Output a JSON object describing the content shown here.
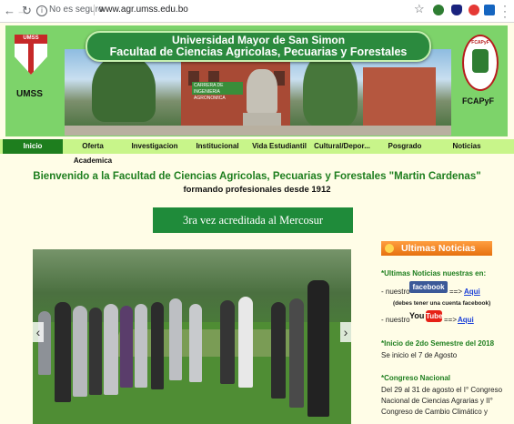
{
  "browser": {
    "security_label": "No es seguro",
    "url": "www.agr.umss.edu.bo"
  },
  "header": {
    "title_line1": "Universidad Mayor de San Simon",
    "title_line2": "Facultad de Ciencias Agricolas, Pecuarias y Forestales",
    "left_logo_label": "UMSS",
    "left_logo_text": "UMSS",
    "right_logo_label": "FCAPyF",
    "right_logo_text": "FCAPyF",
    "photo_sign": "CARRERA DE INGENIERIA AGRONOMICA"
  },
  "nav": {
    "items": [
      "Inicio",
      "Oferta Academica",
      "Investigacion",
      "Institucional",
      "Vida Estudiantil",
      "Cultural/Depor...",
      "Posgrado",
      "Noticias"
    ],
    "active": "Inicio"
  },
  "main": {
    "welcome": "Bienvenido a la Facultad de Ciencias Agricolas, Pecuarias y Forestales \"Martin Cardenas\"",
    "since": "formando profesionales desde 1912",
    "accreditation": "3ra vez acreditada al Mercosur",
    "carousel_prev": "‹",
    "carousel_next": "›"
  },
  "sidebar": {
    "header": "Ultimas Noticias",
    "intro": "*Ultimas Noticias nuestras en:",
    "nuestro": "- nuestro",
    "facebook": "facebook",
    "arrow": "==>",
    "aqui": "Aqui",
    "fb_note": "(debes tener una cuenta facebook)",
    "youtube_you": "You",
    "youtube_tube": "Tube",
    "semester_title": "*Inicio de 2do Semestre del 2018",
    "semester_text": "Se inicio  el 7 de Agosto",
    "congress_title": "*Congreso Nacional",
    "congress_line1": "Del 29 al 31 de agosto el I° Congreso",
    "congress_line2": "Nacional de Ciencias Agrarias y II°",
    "congress_line3": "Congreso de Cambio Climático y"
  }
}
